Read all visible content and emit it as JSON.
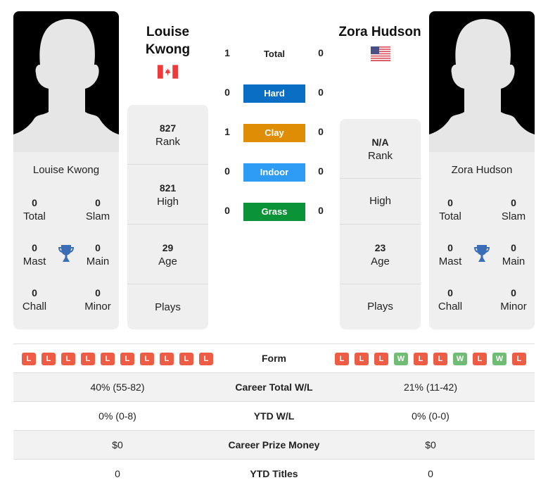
{
  "colors": {
    "hard": "#0a6ec5",
    "clay": "#de8d05",
    "indoor": "#2e9cf4",
    "grass": "#0a9437",
    "loss": "#ef5c45",
    "win": "#6fbd75",
    "trophy": "#3a6db5"
  },
  "player_left": {
    "name": "Louise Kwong",
    "flag": "canada-flag",
    "titles": {
      "total": {
        "value": "0",
        "label": "Total"
      },
      "slam": {
        "value": "0",
        "label": "Slam"
      },
      "mast": {
        "value": "0",
        "label": "Mast"
      },
      "main": {
        "value": "0",
        "label": "Main"
      },
      "chall": {
        "value": "0",
        "label": "Chall"
      },
      "minor": {
        "value": "0",
        "label": "Minor"
      }
    },
    "info": {
      "rank": {
        "value": "827",
        "label": "Rank"
      },
      "high": {
        "value": "821",
        "label": "High"
      },
      "age": {
        "value": "29",
        "label": "Age"
      },
      "plays": {
        "value": "",
        "label": "Plays"
      }
    },
    "form": [
      "L",
      "L",
      "L",
      "L",
      "L",
      "L",
      "L",
      "L",
      "L",
      "L"
    ]
  },
  "player_right": {
    "name": "Zora Hudson",
    "flag": "usa-flag",
    "titles": {
      "total": {
        "value": "0",
        "label": "Total"
      },
      "slam": {
        "value": "0",
        "label": "Slam"
      },
      "mast": {
        "value": "0",
        "label": "Mast"
      },
      "main": {
        "value": "0",
        "label": "Main"
      },
      "chall": {
        "value": "0",
        "label": "Chall"
      },
      "minor": {
        "value": "0",
        "label": "Minor"
      }
    },
    "info": {
      "rank": {
        "value": "N/A",
        "label": "Rank"
      },
      "high": {
        "value": "",
        "label": "High"
      },
      "age": {
        "value": "23",
        "label": "Age"
      },
      "plays": {
        "value": "",
        "label": "Plays"
      }
    },
    "form": [
      "L",
      "L",
      "L",
      "W",
      "L",
      "L",
      "W",
      "L",
      "W",
      "L"
    ]
  },
  "h2h": {
    "total": {
      "label": "Total",
      "left": "1",
      "right": "0"
    },
    "surfaces": [
      {
        "key": "hard",
        "label": "Hard",
        "left": "0",
        "right": "0"
      },
      {
        "key": "clay",
        "label": "Clay",
        "left": "1",
        "right": "0"
      },
      {
        "key": "indoor",
        "label": "Indoor",
        "left": "0",
        "right": "0"
      },
      {
        "key": "grass",
        "label": "Grass",
        "left": "0",
        "right": "0"
      }
    ]
  },
  "comparison": {
    "form_label": "Form",
    "rows": [
      {
        "label": "Career Total W/L",
        "left": "40% (55-82)",
        "right": "21% (11-42)"
      },
      {
        "label": "YTD W/L",
        "left": "0% (0-8)",
        "right": "0% (0-0)"
      },
      {
        "label": "Career Prize Money",
        "left": "$0",
        "right": "$0"
      },
      {
        "label": "YTD Titles",
        "left": "0",
        "right": "0"
      }
    ]
  }
}
